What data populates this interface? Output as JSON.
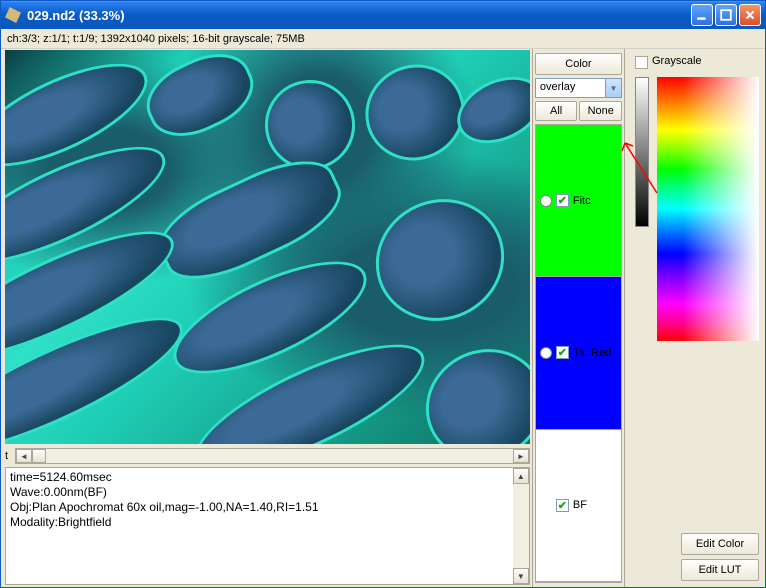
{
  "window": {
    "title": "029.nd2 (33.3%)"
  },
  "metabar": "ch:3/3; z:1/1; t:1/9; 1392x1040 pixels; 16-bit grayscale; 75MB",
  "slider_label": "t",
  "info": {
    "line1": "time=5124.60msec",
    "line2": "Wave:0.00nm(BF)",
    "line3": "Obj:Plan Apochromat 60x oil,mag=-1.00,NA=1.40,RI=1.51",
    "line4": "Modality:Brightfield"
  },
  "mid": {
    "color_btn": "Color",
    "dropdown_value": "overlay",
    "all_btn": "All",
    "none_btn": "None",
    "channels": [
      {
        "name": "Fitc",
        "checked": true,
        "color": "green"
      },
      {
        "name": "Tx. Red",
        "checked": true,
        "color": "blue"
      },
      {
        "name": "BF",
        "checked": true,
        "color": "white"
      }
    ]
  },
  "right": {
    "grayscale_label": "Grayscale",
    "grayscale_checked": false,
    "edit_color": "Edit Color",
    "edit_lut": "Edit LUT"
  }
}
